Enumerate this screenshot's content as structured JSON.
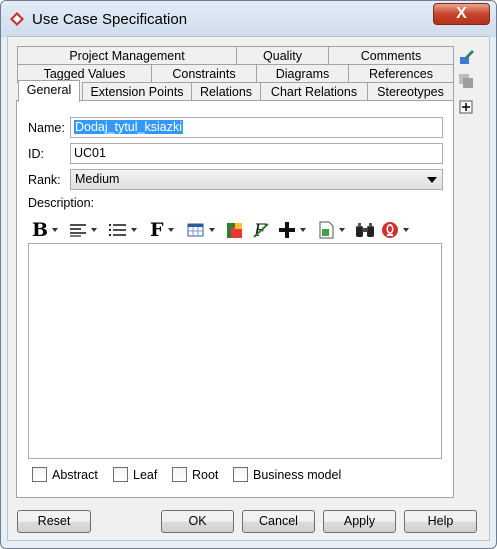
{
  "window": {
    "title": "Use Case Specification",
    "close_glyph": "X"
  },
  "tabs": {
    "row1": [
      "Project Management",
      "Quality",
      "Comments"
    ],
    "row2": [
      "Tagged Values",
      "Constraints",
      "Diagrams",
      "References"
    ],
    "row3": [
      "General",
      "Extension Points",
      "Relations",
      "Chart Relations",
      "Stereotypes"
    ],
    "active": "General"
  },
  "form": {
    "name_label": "Name:",
    "name_value": "Dodaj_tytul_ksiazki",
    "id_label": "ID:",
    "id_value": "UC01",
    "rank_label": "Rank:",
    "rank_value": "Medium",
    "description_label": "Description:"
  },
  "editor_toolbar": {
    "icons": [
      "bold-icon",
      "align-icon",
      "list-icon",
      "font-icon",
      "table-icon",
      "color-icon",
      "formula-icon",
      "insert-icon",
      "document-icon",
      "find-icon",
      "spellcheck-icon"
    ],
    "bold_glyph": "B",
    "font_glyph": "F"
  },
  "checkboxes": [
    {
      "label": "Abstract",
      "checked": false
    },
    {
      "label": "Leaf",
      "checked": false
    },
    {
      "label": "Root",
      "checked": false
    },
    {
      "label": "Business model",
      "checked": false
    }
  ],
  "buttons": {
    "reset": "Reset",
    "ok": "OK",
    "cancel": "Cancel",
    "apply": "Apply",
    "help": "Help"
  },
  "colors": {
    "selection": "#3399ff",
    "close_button": "#c7442a",
    "title_icon": "#c0392b"
  }
}
